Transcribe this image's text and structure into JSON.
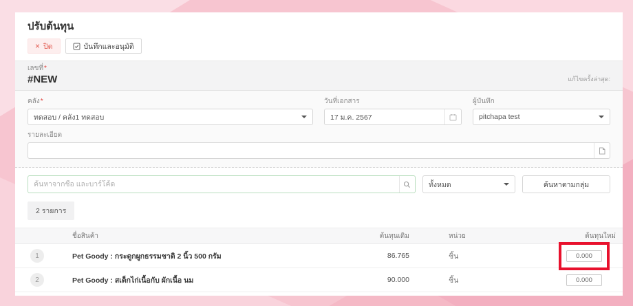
{
  "page": {
    "title": "ปรับต้นทุน"
  },
  "toolbar": {
    "close_label": "ปิด",
    "close_icon_glyph": "×",
    "save_approve_label": "บันทึกและอนุมัติ"
  },
  "document": {
    "number_label": "เลขที่",
    "required_mark": "*",
    "number_value": "#NEW",
    "last_edited_label": "แก้ไขครั้งล่าสุด:"
  },
  "fields": {
    "warehouse_label": "คลัง",
    "warehouse_required_mark": "*",
    "warehouse_value": "ทดสอบ / คลัง1 ทดสอบ",
    "date_label": "วันที่เอกสาร",
    "date_value": "17 ม.ค. 2567",
    "recorder_label": "ผู้บันทึก",
    "recorder_value": "pitchapa test",
    "details_label": "รายละเอียด",
    "details_value": ""
  },
  "search": {
    "placeholder": "ค้นหาจากชื่อ และบาร์โค้ด",
    "category_value": "ทั้งหมด",
    "group_search_label": "ค้นหาตามกลุ่ม"
  },
  "items": {
    "count_label": "2 รายการ"
  },
  "table": {
    "columns": {
      "name": "ชื่อสินค้า",
      "old_cost": "ต้นทุนเดิม",
      "unit": "หน่วย",
      "new_cost": "ต้นทุนใหม่"
    },
    "rows": [
      {
        "no": "1",
        "name": "Pet Goody : กระดูกผูกธรรมชาติ 2 นิ้ว 500 กรัม",
        "old_cost": "86.765",
        "unit": "ชิ้น",
        "new_cost": "0.000"
      },
      {
        "no": "2",
        "name": "Pet Goody : สเต็กไก่เนื้อกับ ผักเนื้อ นม",
        "old_cost": "90.000",
        "unit": "ชิ้น",
        "new_cost": "0.000"
      }
    ]
  },
  "annotation": {
    "type": "highlight-box",
    "target": "row-1-new-cost-input",
    "color": "#e8112d"
  },
  "colors": {
    "pink_background": "#f7c5d0",
    "accent_red": "#e25b50",
    "search_border": "#b7ddbd",
    "highlight_box": "#e8112d"
  }
}
